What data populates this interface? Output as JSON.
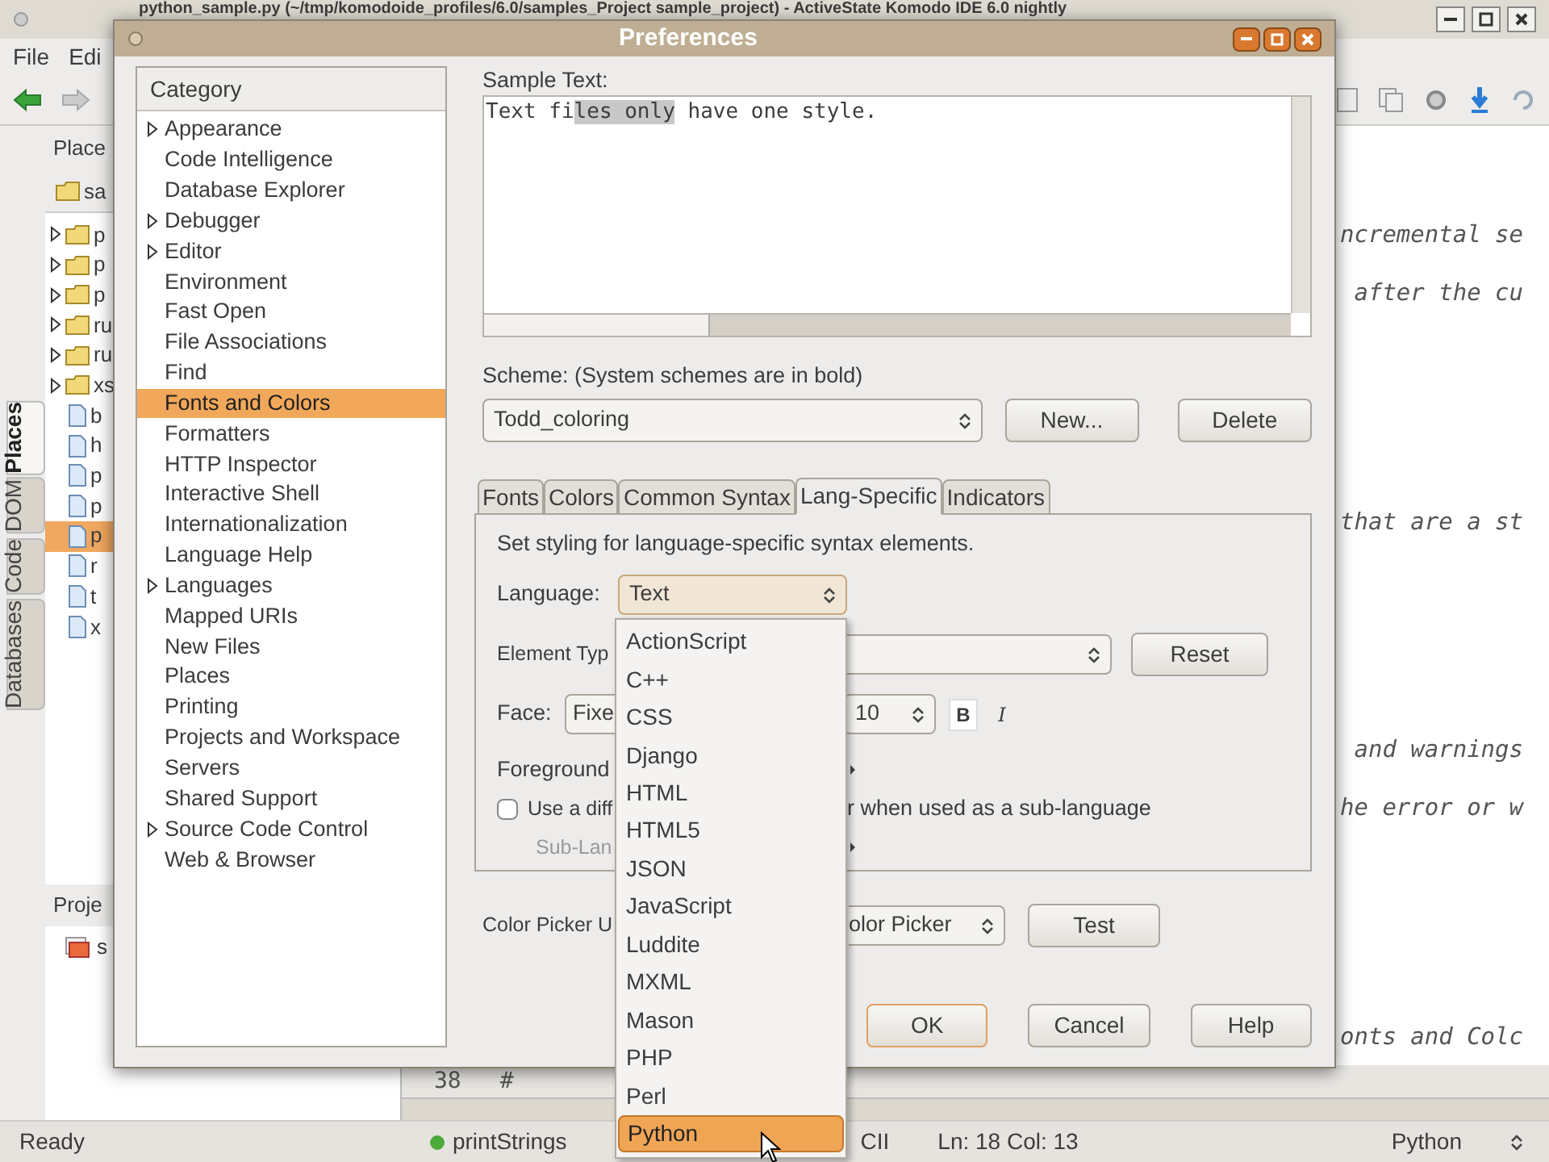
{
  "ide": {
    "title": "python_sample.py (~/tmp/komodoide_profiles/6.0/samples_Project sample_project) - ActiveState Komodo IDE 6.0 nightly",
    "menu": [
      "File",
      "Edi"
    ],
    "side_tabs": [
      {
        "label": "Places",
        "selected": true
      },
      {
        "label": "DOM",
        "selected": false
      },
      {
        "label": "Code",
        "selected": false
      },
      {
        "label": "Databases",
        "selected": false
      }
    ],
    "places_header": "Place",
    "places_root": "sa",
    "tree": [
      {
        "kind": "folder",
        "label": "p",
        "selected": false
      },
      {
        "kind": "folder",
        "label": "p",
        "selected": false
      },
      {
        "kind": "folder",
        "label": "p",
        "selected": false
      },
      {
        "kind": "folder",
        "label": "ru",
        "selected": false
      },
      {
        "kind": "folder",
        "label": "ru",
        "selected": false
      },
      {
        "kind": "folder",
        "label": "xs",
        "selected": false
      },
      {
        "kind": "file",
        "label": "b",
        "selected": false
      },
      {
        "kind": "file",
        "label": "h",
        "selected": false
      },
      {
        "kind": "file",
        "label": "p",
        "selected": false
      },
      {
        "kind": "file",
        "label": "p",
        "selected": false
      },
      {
        "kind": "file",
        "label": "p",
        "selected": true
      },
      {
        "kind": "file",
        "label": "r",
        "selected": false
      },
      {
        "kind": "file",
        "label": "t",
        "selected": false
      },
      {
        "kind": "file",
        "label": "x",
        "selected": false
      }
    ],
    "projects_header": "Proje",
    "project": "s",
    "editor_lines": [
      "ncremental se",
      "after the cu",
      "that are a st",
      "and warnings",
      "he error or w",
      "onts and Colc"
    ],
    "line_number": "38",
    "line_text": "#",
    "status": {
      "ready": "Ready",
      "function": "printStrings",
      "encoding": "CII",
      "position": "Ln: 18 Col: 13",
      "language": "Python"
    }
  },
  "dialog": {
    "title": "Preferences",
    "category_header": "Category",
    "categories": [
      {
        "label": "Appearance",
        "expandable": true,
        "selected": false
      },
      {
        "label": "Code Intelligence",
        "expandable": false,
        "selected": false
      },
      {
        "label": "Database Explorer",
        "expandable": false,
        "selected": false
      },
      {
        "label": "Debugger",
        "expandable": true,
        "selected": false
      },
      {
        "label": "Editor",
        "expandable": true,
        "selected": false
      },
      {
        "label": "Environment",
        "expandable": false,
        "selected": false
      },
      {
        "label": "Fast Open",
        "expandable": false,
        "selected": false
      },
      {
        "label": "File Associations",
        "expandable": false,
        "selected": false
      },
      {
        "label": "Find",
        "expandable": false,
        "selected": false
      },
      {
        "label": "Fonts and Colors",
        "expandable": false,
        "selected": true
      },
      {
        "label": "Formatters",
        "expandable": false,
        "selected": false
      },
      {
        "label": "HTTP Inspector",
        "expandable": false,
        "selected": false
      },
      {
        "label": "Interactive Shell",
        "expandable": false,
        "selected": false
      },
      {
        "label": "Internationalization",
        "expandable": false,
        "selected": false
      },
      {
        "label": "Language Help",
        "expandable": false,
        "selected": false
      },
      {
        "label": "Languages",
        "expandable": true,
        "selected": false
      },
      {
        "label": "Mapped URIs",
        "expandable": false,
        "selected": false
      },
      {
        "label": "New Files",
        "expandable": false,
        "selected": false
      },
      {
        "label": "Places",
        "expandable": false,
        "selected": false
      },
      {
        "label": "Printing",
        "expandable": false,
        "selected": false
      },
      {
        "label": "Projects and Workspace",
        "expandable": false,
        "selected": false
      },
      {
        "label": "Servers",
        "expandable": false,
        "selected": false
      },
      {
        "label": "Shared Support",
        "expandable": false,
        "selected": false
      },
      {
        "label": "Source Code Control",
        "expandable": true,
        "selected": false
      },
      {
        "label": "Web & Browser",
        "expandable": false,
        "selected": false
      }
    ],
    "sample_label": "Sample Text:",
    "sample_text": {
      "before": "Text fi",
      "selected": "les only",
      "after": " have one style."
    },
    "scheme_label": "Scheme: (System schemes are in bold)",
    "scheme": "Todd_coloring",
    "new_button": "New...",
    "delete_button": "Delete",
    "tabs": [
      {
        "label": "Fonts",
        "selected": false
      },
      {
        "label": "Colors",
        "selected": false
      },
      {
        "label": "Common Syntax",
        "selected": false
      },
      {
        "label": "Lang-Specific",
        "selected": true
      },
      {
        "label": "Indicators",
        "selected": false
      }
    ],
    "description": "Set styling for language-specific syntax elements.",
    "language_label": "Language:",
    "language": "Text",
    "element_type_label": "Element Typ",
    "reset_button": "Reset",
    "face_label": "Face:",
    "face": "Fixe",
    "size": "10",
    "bold": {
      "label": "B",
      "on": true
    },
    "italic": {
      "label": "I",
      "on": false
    },
    "foreground_label": "Foreground",
    "sublanguage": {
      "checked": false,
      "label_start": "Use a diff",
      "label_end": "r when used as a sub-language"
    },
    "sublanguage_label": "Sub-Lan",
    "color_picker_label": "Color Picker U",
    "color_picker": "olor Picker",
    "test_button": "Test",
    "buttons": [
      "OK",
      "Cancel",
      "Help"
    ]
  },
  "dropdown": [
    {
      "label": "ActionScript",
      "selected": false
    },
    {
      "label": "C++",
      "selected": false
    },
    {
      "label": "CSS",
      "selected": false
    },
    {
      "label": "Django",
      "selected": false
    },
    {
      "label": "HTML",
      "selected": false
    },
    {
      "label": "HTML5",
      "selected": false
    },
    {
      "label": "JSON",
      "selected": false
    },
    {
      "label": "JavaScript",
      "selected": false
    },
    {
      "label": "Luddite",
      "selected": false
    },
    {
      "label": "MXML",
      "selected": false
    },
    {
      "label": "Mason",
      "selected": false
    },
    {
      "label": "PHP",
      "selected": false
    },
    {
      "label": "Perl",
      "selected": false
    },
    {
      "label": "Python",
      "selected": true
    }
  ]
}
